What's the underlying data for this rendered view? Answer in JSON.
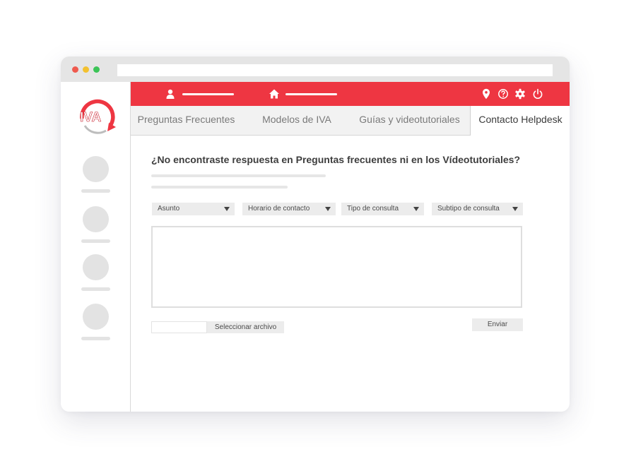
{
  "brand": {
    "logo_text": "IVA",
    "accent_color": "#ee3642"
  },
  "browser": {
    "traffic_lights": [
      "#ef5a4e",
      "#f3c12f",
      "#3cc457"
    ]
  },
  "topbar": {
    "icons": [
      "user-icon",
      "home-icon",
      "location-pin-icon",
      "help-icon",
      "gear-icon",
      "power-icon"
    ]
  },
  "tabs": [
    {
      "label": "Preguntas Frecuentes",
      "active": false
    },
    {
      "label": "Modelos de IVA",
      "active": false
    },
    {
      "label": "Guías y videotutoriales",
      "active": false
    },
    {
      "label": "Contacto Helpdesk",
      "active": true
    }
  ],
  "form": {
    "heading": "¿No encontraste respuesta en Preguntas frecuentes ni en los Vídeotutoriales?",
    "selects": [
      {
        "label": "Asunto"
      },
      {
        "label": "Horario de contacto"
      },
      {
        "label": "Tipo de consulta"
      },
      {
        "label": "Subtipo de consulta"
      }
    ],
    "message_value": "",
    "file_button_label": "Seleccionar archivo",
    "submit_label": "Enviar"
  }
}
